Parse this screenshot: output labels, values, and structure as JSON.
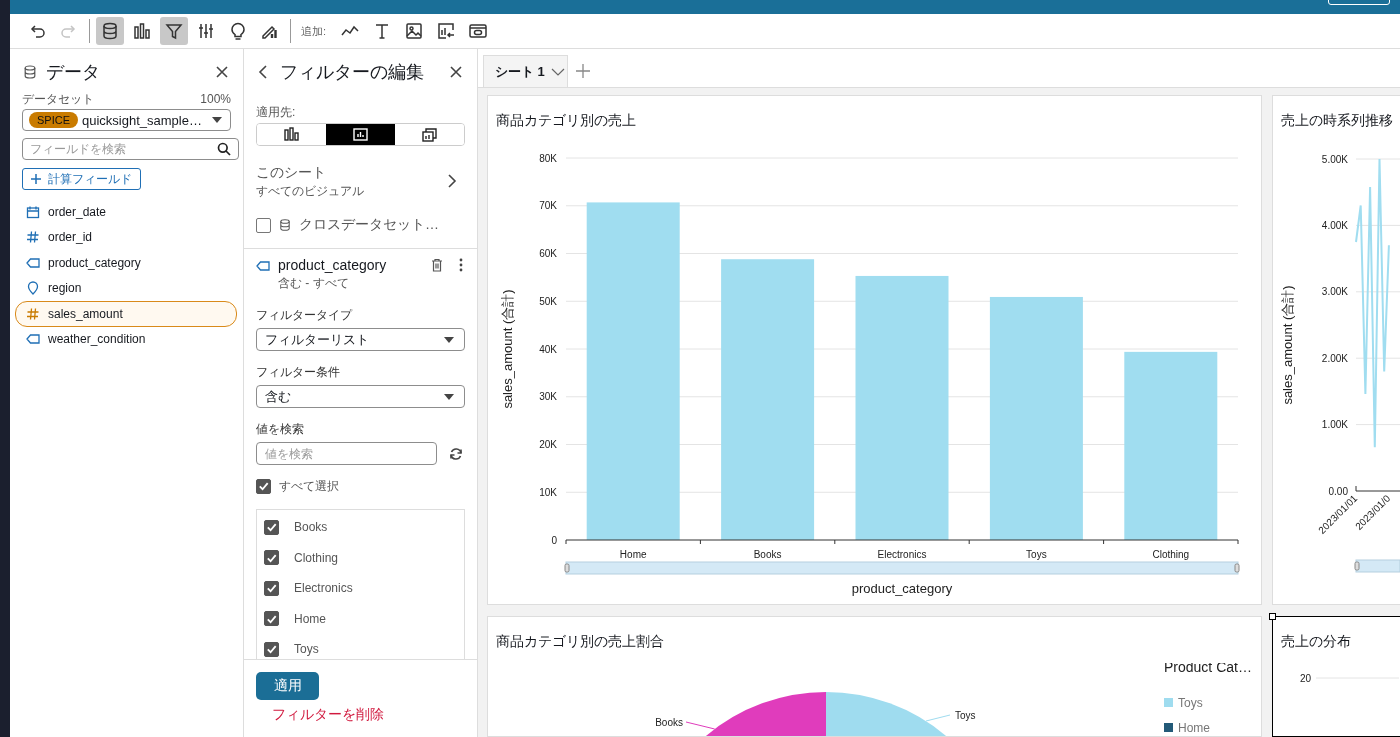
{
  "toolbar": {
    "history": [
      {
        "kind": "undo",
        "disabled": false
      },
      {
        "kind": "redo",
        "disabled": true
      }
    ],
    "panels": [
      {
        "kind": "data",
        "selected": true
      },
      {
        "kind": "visuals",
        "selected": false
      },
      {
        "kind": "filter",
        "selected": true
      },
      {
        "kind": "properties",
        "selected": false
      },
      {
        "kind": "insights",
        "selected": false
      },
      {
        "kind": "story",
        "selected": false
      }
    ],
    "add_label": "追加:",
    "add": [
      {
        "kind": "line"
      },
      {
        "kind": "text"
      },
      {
        "kind": "image"
      },
      {
        "kind": "insight_chart"
      },
      {
        "kind": "embed"
      }
    ]
  },
  "data_panel": {
    "title": "データ",
    "dataset_label": "データセット",
    "dataset_percent": "100%",
    "dataset": {
      "badge": "SPICE",
      "name": "quicksight_sample…"
    },
    "search": {
      "placeholder": "フィールドを検索"
    },
    "add_field_button": "計算フィールド",
    "fields": [
      {
        "name": "order_date",
        "kind": "date",
        "selected": false
      },
      {
        "name": "order_id",
        "kind": "number",
        "selected": false
      },
      {
        "name": "product_category",
        "kind": "string",
        "selected": false
      },
      {
        "name": "region",
        "kind": "geo",
        "selected": false
      },
      {
        "name": "sales_amount",
        "kind": "number",
        "selected": true
      },
      {
        "name": "weather_condition",
        "kind": "string",
        "selected": false
      }
    ]
  },
  "filter_panel": {
    "title": "フィルターの編集",
    "apply_to_label": "適用先:",
    "apply_to": [
      {
        "kind": "visual",
        "selected": false
      },
      {
        "kind": "sheet",
        "selected": true
      },
      {
        "kind": "all",
        "selected": false
      }
    ],
    "scope": {
      "title": "このシート",
      "subtitle": "すべてのビジュアル"
    },
    "cross_dataset": {
      "label": "クロスデータセット…",
      "checked": false
    },
    "filter": {
      "field": "product_category",
      "summary": "含む - すべて",
      "type_label": "フィルタータイプ",
      "type_value": "フィルターリスト",
      "condition_label": "フィルター条件",
      "condition_value": "含む",
      "search_label": "値を検索",
      "search": {
        "placeholder": "値を検索"
      },
      "select_all": {
        "label": "すべて選択",
        "checked": true
      },
      "values": [
        {
          "label": "Books",
          "checked": true
        },
        {
          "label": "Clothing",
          "checked": true
        },
        {
          "label": "Electronics",
          "checked": true
        },
        {
          "label": "Home",
          "checked": true
        },
        {
          "label": "Toys",
          "checked": true
        }
      ]
    },
    "apply_button": "適用",
    "delete_link": "フィルターを削除"
  },
  "sheet_tabs": [
    {
      "label": "シート 1",
      "selected": true
    }
  ],
  "bar_visual": {
    "chart_data": {
      "type": "bar",
      "title": "商品カテゴリ別の売上",
      "xlabel": "product_category",
      "ylabel": "sales_amount (合計)",
      "categories": [
        "Home",
        "Books",
        "Electronics",
        "Toys",
        "Clothing"
      ],
      "values": [
        70700,
        58800,
        55300,
        50900,
        39400
      ],
      "ylim": [
        0,
        80000
      ],
      "grid": true,
      "yticks": [
        {
          "value": 0,
          "label": "0"
        },
        {
          "value": 10000,
          "label": "10K"
        },
        {
          "value": 20000,
          "label": "20K"
        },
        {
          "value": 30000,
          "label": "30K"
        },
        {
          "value": 40000,
          "label": "40K"
        },
        {
          "value": 50000,
          "label": "50K"
        },
        {
          "value": 60000,
          "label": "60K"
        },
        {
          "value": 70000,
          "label": "70K"
        },
        {
          "value": 80000,
          "label": "80K"
        }
      ]
    }
  },
  "line_visual": {
    "chart_data": {
      "type": "line",
      "title": "売上の時系列推移",
      "ylabel": "sales_amount (合計)",
      "categories": [
        "2023/01/01",
        null,
        null,
        null,
        null,
        null,
        null,
        "2023/01/0"
      ],
      "values": [
        3750,
        4300,
        1460,
        4580,
        660,
        5000,
        1800,
        3700
      ],
      "ylim": [
        0,
        5000
      ],
      "grid": true,
      "yticks": [
        {
          "value": 0,
          "label": "0.00"
        },
        {
          "value": 1000,
          "label": "1.00K"
        },
        {
          "value": 2000,
          "label": "2.00K"
        },
        {
          "value": 3000,
          "label": "3.00K"
        },
        {
          "value": 4000,
          "label": "4.00K"
        },
        {
          "value": 5000,
          "label": "5.00K"
        }
      ]
    }
  },
  "pie_visual": {
    "title": "商品カテゴリ別の売上割合",
    "legend_title": "Product Cat…",
    "legend": [
      {
        "label": "Toys",
        "color": "#9fdcef"
      },
      {
        "label": "Home",
        "color": "#235a78"
      }
    ],
    "slices": [
      {
        "label": "Books",
        "color": "#e03cbc"
      },
      {
        "label": "Toys",
        "color": "#9fdcef"
      }
    ]
  },
  "histogram_visual": {
    "title": "売上の分布",
    "selected": true,
    "y_tick_label": "20"
  }
}
